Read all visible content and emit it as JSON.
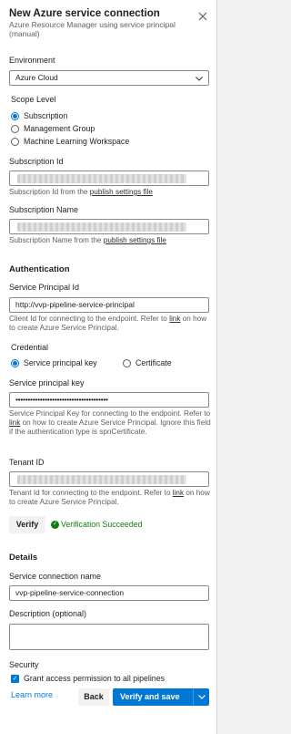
{
  "header": {
    "title": "New Azure service connection",
    "subtitle": "Azure Resource Manager using service principal (manual)"
  },
  "environment": {
    "label": "Environment",
    "value": "Azure Cloud"
  },
  "scope": {
    "label": "Scope Level",
    "options": [
      "Subscription",
      "Management Group",
      "Machine Learning Workspace"
    ],
    "selected": "Subscription"
  },
  "subscription_id": {
    "label": "Subscription Id",
    "help_prefix": "Subscription Id from the ",
    "help_link": "publish settings file"
  },
  "subscription_name": {
    "label": "Subscription Name",
    "help_prefix": "Subscription Name from the ",
    "help_link": "publish settings file"
  },
  "authentication": {
    "section": "Authentication",
    "principal_id_label": "Service Principal Id",
    "principal_id_value": "http://vvp-pipeline-service-principal",
    "principal_id_help_1": "Client Id for connecting to the endpoint. Refer to",
    "principal_id_help_link": "link",
    "principal_id_help_2": " on how to create Azure Service Principal.",
    "credential_label": "Credential",
    "credential_options": [
      "Service principal key",
      "Certificate"
    ],
    "credential_selected": "Service principal key",
    "key_label": "Service principal key",
    "key_value": "••••••••••••••••••••••••••••••••••••••",
    "key_help_1": "Service Principal Key for connecting to the endpoint. Refer to ",
    "key_help_link": "link",
    "key_help_2": " on how to create Azure Service Principal. Ignore this field if the authentication type is spnCertificate.",
    "tenant_label": "Tenant ID",
    "tenant_help_1": "Tenant Id for connecting to the endpoint. Refer to",
    "tenant_help_link": "link",
    "tenant_help_2": " on how to create Azure Service Principal.",
    "verify_button": "Verify",
    "verify_status": "Verification Succeeded"
  },
  "details": {
    "section": "Details",
    "name_label": "Service connection name",
    "name_value": "vvp-pipeline-service-connection",
    "description_label": "Description (optional)",
    "description_value": ""
  },
  "security": {
    "label": "Security",
    "grant_label": "Grant access permission to all pipelines",
    "grant_checked": true
  },
  "footer": {
    "learn_more": "Learn more",
    "back": "Back",
    "primary": "Verify and save"
  },
  "colors": {
    "accent": "#0078d4",
    "success": "#107c10"
  },
  "icons": [
    "close-icon",
    "chevron-down-icon",
    "check-circle-icon",
    "checkbox-checked-icon"
  ]
}
